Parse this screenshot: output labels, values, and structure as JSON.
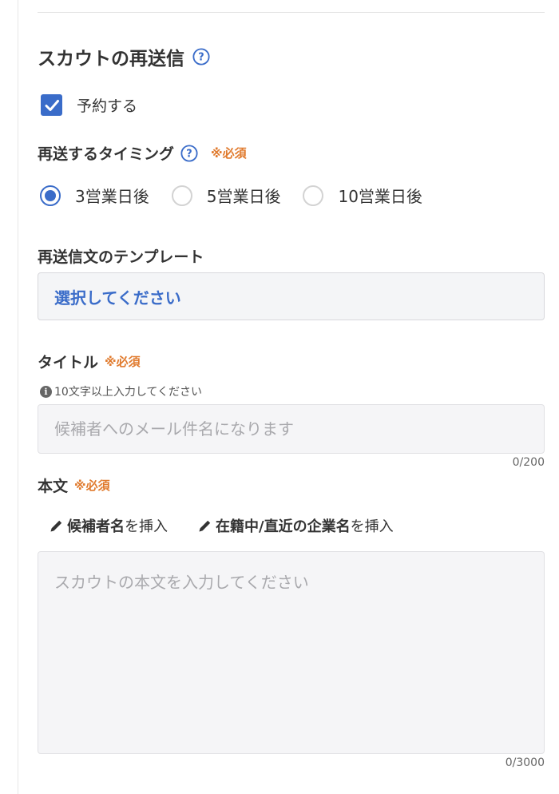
{
  "section": {
    "title": "スカウトの再送信"
  },
  "reserve": {
    "label": "予約する",
    "checked": true
  },
  "timing": {
    "label": "再送するタイミング",
    "required": "※必須",
    "options": [
      "3営業日後",
      "5営業日後",
      "10営業日後"
    ],
    "selected": "3営業日後"
  },
  "template": {
    "label": "再送信文のテンプレート",
    "placeholder": "選択してください"
  },
  "title_field": {
    "label": "タイトル",
    "required": "※必須",
    "hint": "10文字以上入力してください",
    "placeholder": "候補者へのメール件名になります",
    "counter": "0/200"
  },
  "body_field": {
    "label": "本文",
    "required": "※必須",
    "insert_buttons": [
      {
        "strong": "候補者名",
        "suffix": "を挿入"
      },
      {
        "strong": "在籍中/直近の企業名",
        "suffix": "を挿入"
      }
    ],
    "placeholder": "スカウトの本文を入力してください",
    "counter": "0/3000"
  },
  "colors": {
    "accent": "#3a6cc9",
    "required": "#e07a2d"
  },
  "icons": {
    "help": "question-circle-icon",
    "check": "checkmark-icon",
    "info": "info-icon",
    "pencil": "pencil-icon"
  }
}
